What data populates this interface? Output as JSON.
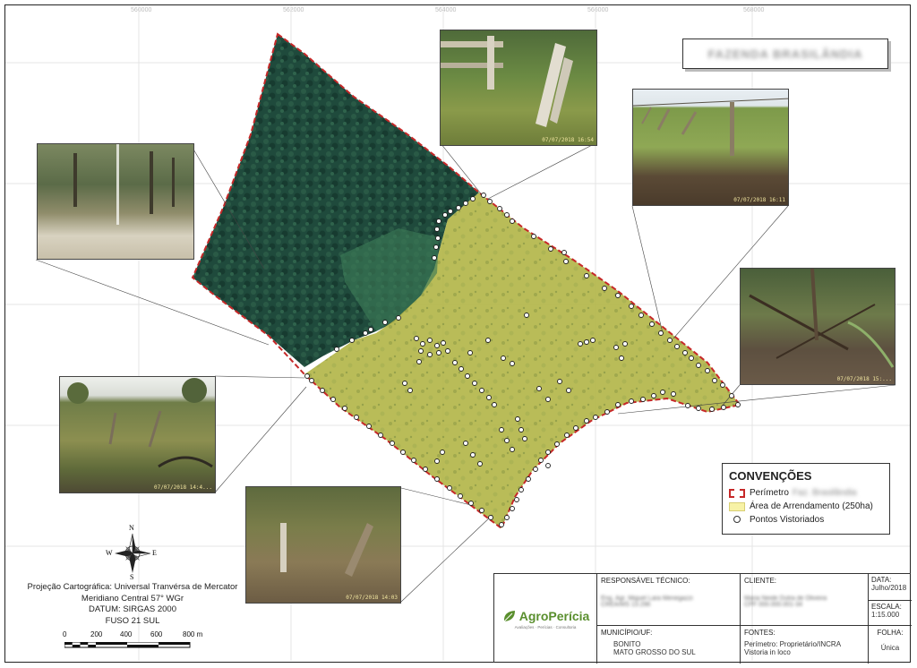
{
  "title": "FAZENDA BRASILÂNDIA",
  "coords_top": [
    "560000",
    "562000",
    "564000",
    "566000",
    "568000"
  ],
  "photos": [
    {
      "id": "p1",
      "stamp": "07/07/2018 16:54"
    },
    {
      "id": "p2",
      "stamp": "07/07/2018 16:11"
    },
    {
      "id": "p3",
      "stamp": ""
    },
    {
      "id": "p4",
      "stamp": "07/07/2018 15:..."
    },
    {
      "id": "p5",
      "stamp": "07/07/2018 14:4..."
    },
    {
      "id": "p6",
      "stamp": "07/07/2018 14:03"
    }
  ],
  "legend": {
    "title": "CONVENÇÕES",
    "perimetro": "Perímetro",
    "perimetro_name": "Faz. Brasilândia",
    "area": "Área de Arrendamento (250ha)",
    "pontos": "Pontos Vistoriados",
    "colors": {
      "perimetro": "#c62828",
      "area": "#f7f2a6"
    }
  },
  "compass": {
    "n": "N",
    "s": "S",
    "e": "E",
    "w": "W"
  },
  "projection": {
    "line1": "Projeção Cartográfica: Universal Tranvérsa de Mercator",
    "line2": "Meridiano Central 57° WGr",
    "line3": "DATUM: SIRGAS 2000",
    "line4": "FUSO 21 SUL"
  },
  "scale": {
    "labels": [
      "0",
      "200",
      "400",
      "600",
      "800 m"
    ]
  },
  "info": {
    "logo": "AgroPerícia",
    "logo_sub": "Avaliações · Perícias · Consultoria",
    "resp_label": "RESPONSÁVEL TÉCNICO:",
    "resp_name": "Eng. Agr. Miguel Lara Menegazzi",
    "resp_crea": "CREA/MS 13.296",
    "cliente_label": "CLIENTE:",
    "cliente_name": "Maria Neide Dutra de Oliveira",
    "cliente_cpf": "CPF 000.000.001-34",
    "data_label": "DATA:",
    "data_value": "Julho/2018",
    "escala_label": "ESCALA:",
    "escala_value": "1:15.000",
    "municipio_label": "MUNICÍPIO/UF:",
    "municipio_1": "BONITO",
    "municipio_2": "MATO GROSSO DO SUL",
    "fontes_label": "FONTES:",
    "fontes_1": "Perímetro: Proprietário/INCRA",
    "fontes_2": "Vistoria in loco",
    "folha_label": "FOLHA:",
    "folha_value": "Única"
  }
}
